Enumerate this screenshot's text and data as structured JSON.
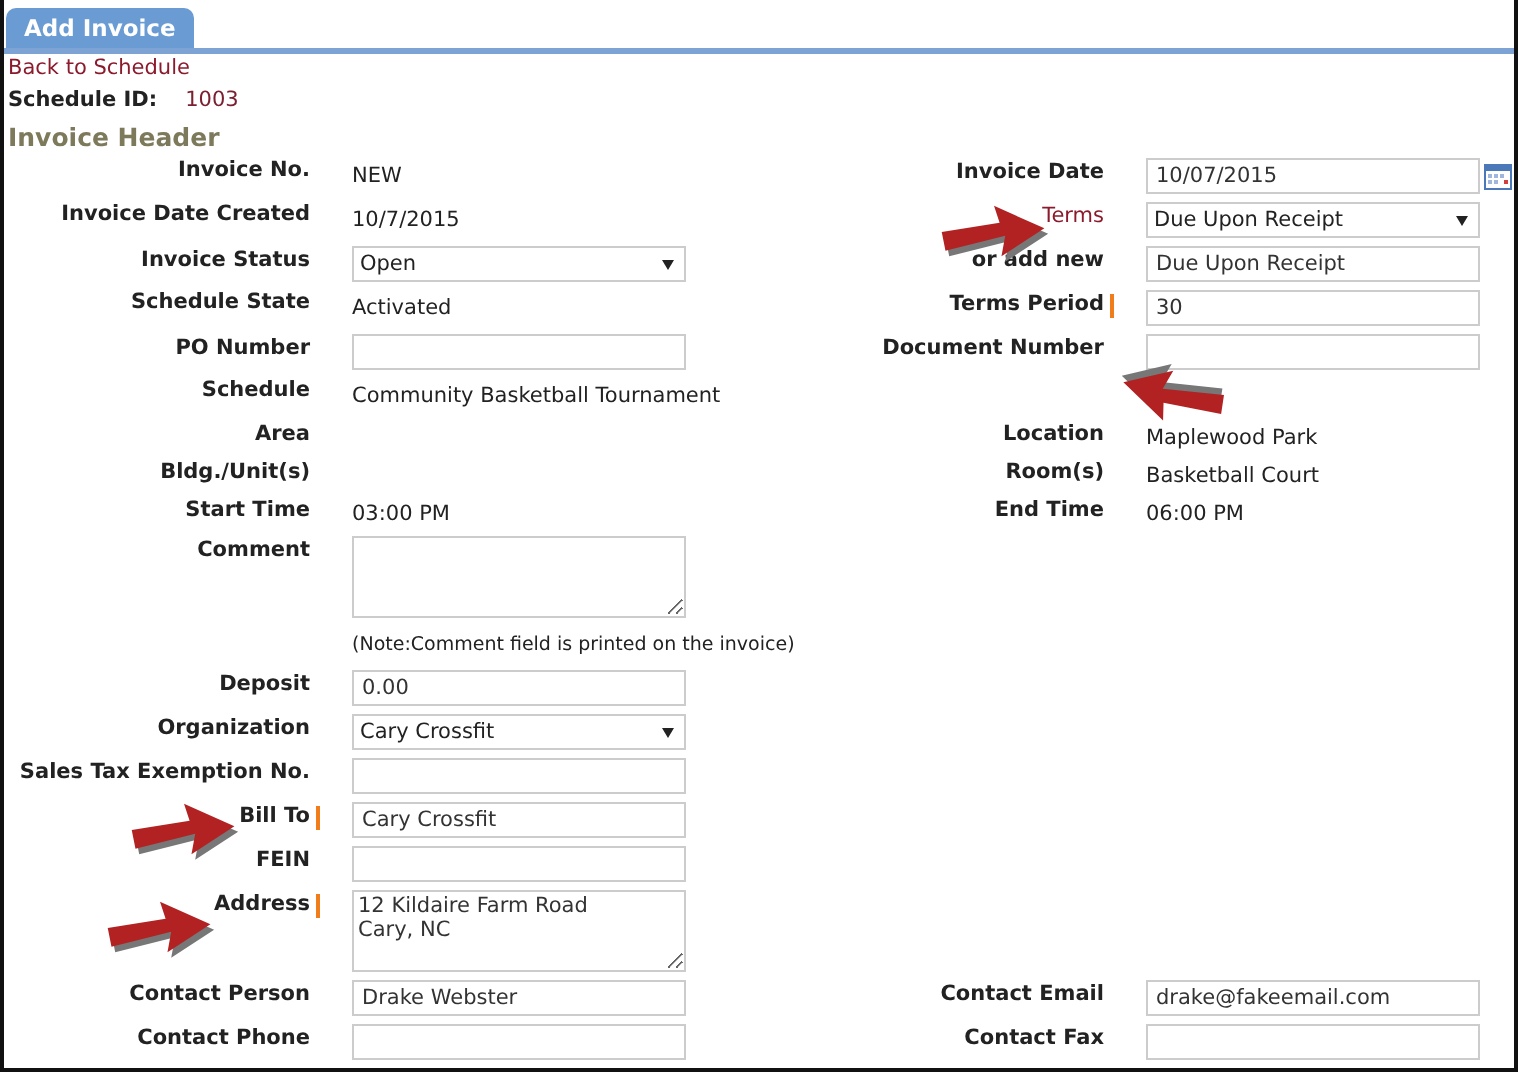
{
  "tabs": [
    {
      "label": "Add Invoice",
      "selected": true
    }
  ],
  "back_link": "Back to Schedule",
  "schedule_id": {
    "label": "Schedule ID:",
    "value": "1003"
  },
  "section_title": "Invoice Header",
  "rows": [
    {
      "left": {
        "label": "Invoice No.",
        "kind": "text",
        "value": "NEW"
      },
      "right": {
        "label": "Invoice Date",
        "kind": "date",
        "value": "10/07/2015"
      }
    },
    {
      "left": {
        "label": "Invoice Date Created",
        "kind": "text",
        "value": "10/7/2015"
      },
      "right": {
        "label": "Terms",
        "label_link": true,
        "kind": "select",
        "value": "Due Upon Receipt"
      }
    },
    {
      "left": {
        "label": "Invoice Status",
        "kind": "select",
        "value": "Open"
      },
      "right": {
        "label": "or add new",
        "kind": "input",
        "value": "Due Upon Receipt"
      }
    },
    {
      "left": {
        "label": "Schedule State",
        "kind": "text",
        "value": "Activated"
      },
      "right": {
        "label": "Terms Period",
        "required": true,
        "kind": "input",
        "value": "30"
      }
    },
    {
      "left": {
        "label": "PO Number",
        "kind": "input"
      },
      "right": {
        "label": "Document Number",
        "kind": "input"
      }
    },
    {
      "left": {
        "label": "Schedule",
        "kind": "text",
        "value": "Community Basketball Tournament"
      }
    },
    {
      "left": {
        "label": "Area",
        "kind": "text"
      },
      "right": {
        "label": "Location",
        "kind": "text",
        "value": "Maplewood Park"
      }
    },
    {
      "left": {
        "label": "Bldg./Unit(s)",
        "kind": "text"
      },
      "right": {
        "label": "Room(s)",
        "kind": "text",
        "value": "Basketball Court"
      }
    },
    {
      "left": {
        "label": "Start Time",
        "kind": "text",
        "value": "03:00 PM"
      },
      "right": {
        "label": "End Time",
        "kind": "text",
        "value": "06:00 PM"
      }
    },
    {
      "left": {
        "label": "Comment",
        "kind": "textarea"
      }
    },
    {
      "left": {
        "kind": "note",
        "value": "(Note:Comment field is printed on the invoice)"
      }
    },
    {
      "left": {
        "label": "Deposit",
        "kind": "input",
        "value": "0.00"
      }
    },
    {
      "left": {
        "label": "Organization",
        "kind": "select",
        "value": "Cary Crossfit"
      }
    },
    {
      "left": {
        "label": "Sales Tax Exemption No.",
        "kind": "input"
      }
    },
    {
      "left": {
        "label": "Bill To",
        "required": true,
        "kind": "input",
        "value": "Cary Crossfit"
      }
    },
    {
      "left": {
        "label": "FEIN",
        "kind": "input"
      }
    },
    {
      "left": {
        "label": "Address",
        "required": true,
        "kind": "textarea",
        "value": "12 Kildaire Farm Road\nCary, NC"
      }
    },
    {
      "left": {
        "label": "Contact Person",
        "kind": "input",
        "value": "Drake Webster"
      },
      "right": {
        "label": "Contact Email",
        "kind": "input",
        "value": "drake@fakeemail.com"
      }
    },
    {
      "left": {
        "label": "Contact Phone",
        "kind": "input"
      },
      "right": {
        "label": "Contact Fax",
        "kind": "input"
      }
    }
  ]
}
